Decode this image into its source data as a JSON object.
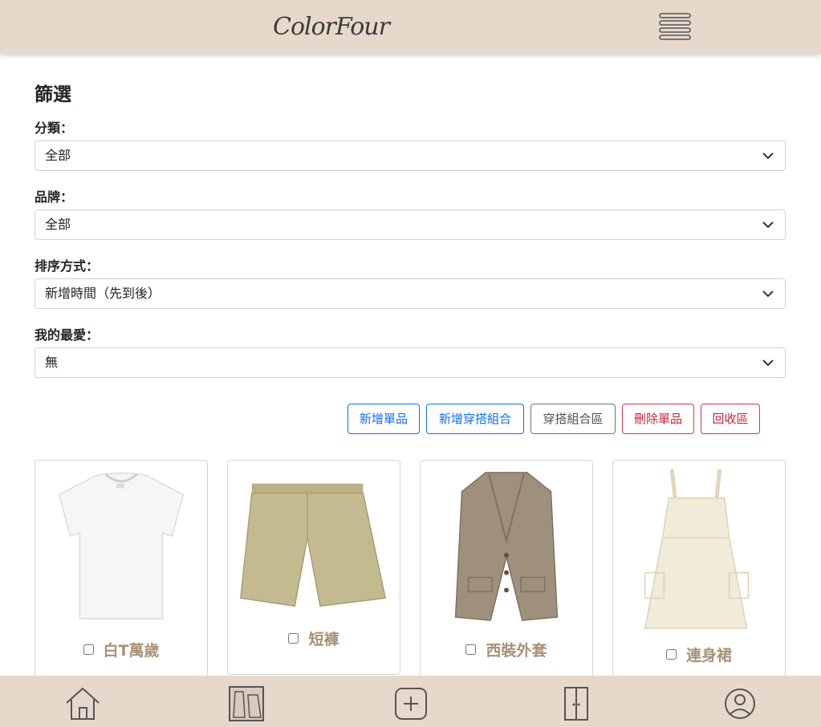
{
  "header": {
    "logo_text": "ColorFour",
    "menu_icon": "hamburger-menu-icon"
  },
  "filter": {
    "title": "篩選",
    "category_label": "分類：",
    "category_value": "全部",
    "brand_label": "品牌：",
    "brand_value": "全部",
    "sort_label": "排序方式：",
    "sort_value": "新增時間（先到後）",
    "favorite_label": "我的最愛：",
    "favorite_value": "無"
  },
  "actions": {
    "add_item": "新增單品",
    "add_outfit": "新增穿搭組合",
    "outfit_zone": "穿搭組合區",
    "delete_item": "刪除單品",
    "recycle_bin": "回收區"
  },
  "items": [
    {
      "name": "白T萬歲",
      "icon": "white-tshirt-image"
    },
    {
      "name": "短褲",
      "icon": "khaki-shorts-image"
    },
    {
      "name": "西裝外套",
      "icon": "suit-jacket-image"
    },
    {
      "name": "連身裙",
      "icon": "cream-dress-image"
    }
  ],
  "bottom_nav": [
    "home-icon",
    "wardrobe-outfits-icon",
    "add-icon",
    "closet-icon",
    "user-profile-icon"
  ],
  "colors": {
    "bar_bg": "#e6d9cb",
    "item_label": "#a89176",
    "primary": "#0d6efd",
    "danger": "#dc3545",
    "secondary": "#6c757d"
  }
}
